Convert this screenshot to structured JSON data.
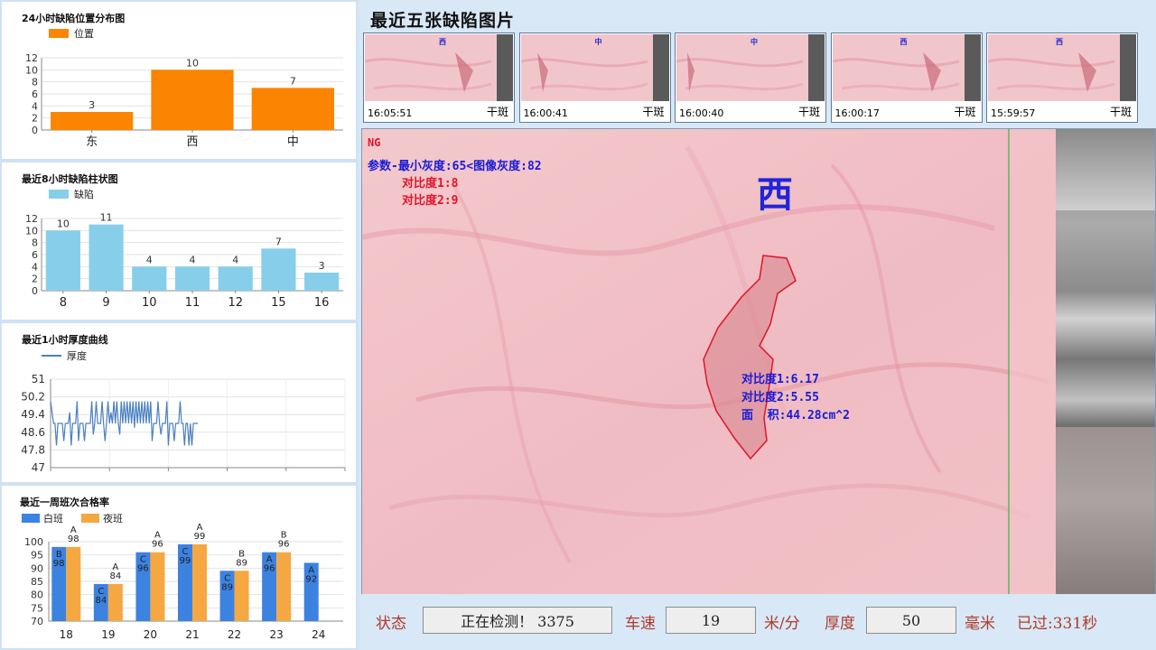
{
  "panels": {
    "position": {
      "title": "24小时缺陷位置分布图",
      "legend": "位置",
      "color": "#fb8500",
      "chart_data": {
        "type": "bar",
        "categories": [
          "东",
          "西",
          "中"
        ],
        "values": [
          3,
          10,
          7
        ],
        "ylim": [
          0,
          12
        ],
        "yticks": [
          0,
          2,
          4,
          6,
          8,
          10,
          12
        ],
        "series": [
          {
            "name": "位置",
            "values": [
              3,
              10,
              7
            ]
          }
        ]
      }
    },
    "hourly": {
      "title": "最近8小时缺陷柱状图",
      "legend": "缺陷",
      "color": "#87ceeb",
      "chart_data": {
        "type": "bar",
        "categories": [
          "8",
          "9",
          "10",
          "11",
          "12",
          "15",
          "16"
        ],
        "values": [
          10,
          11,
          4,
          4,
          4,
          7,
          3
        ],
        "ylim": [
          0,
          12
        ],
        "yticks": [
          0,
          2,
          4,
          6,
          8,
          10,
          12
        ],
        "series": [
          {
            "name": "缺陷",
            "values": [
              10,
              11,
              4,
              4,
              4,
              7,
              3
            ]
          }
        ]
      }
    },
    "thickness": {
      "title": "最近1小时厚度曲线",
      "legend": "厚度",
      "color": "#4a7fc1",
      "chart_data": {
        "type": "line",
        "ylim": [
          47,
          51
        ],
        "yticks": [
          "47",
          "47.8",
          "48.6",
          "49.4",
          "50.2",
          "51"
        ],
        "xlim": [
          0,
          100
        ],
        "x": [
          0,
          1,
          1.5,
          2,
          2.5,
          3,
          3.5,
          4,
          4.5,
          5,
          5.5,
          6,
          6.5,
          7,
          7.5,
          8,
          8.5,
          9,
          9.5,
          10,
          10.5,
          11,
          11.5,
          12,
          12.5,
          13,
          13.5,
          14,
          14.5,
          15,
          15.5,
          16,
          16.5,
          17,
          17.5,
          18,
          18.5,
          19,
          19.5,
          20,
          20.5,
          21,
          21.5,
          22,
          22.5,
          23,
          23.5,
          24,
          24.5,
          25,
          25.5,
          26,
          26.5,
          27,
          27.5,
          28,
          28.5,
          29,
          29.5,
          30,
          30.5,
          31,
          31.5,
          32,
          32.5,
          33,
          33.5,
          34,
          34.5,
          35,
          35.5,
          36,
          36.5,
          37,
          37.5,
          38,
          38.5,
          39,
          39.5,
          40,
          40.5,
          41,
          41.5,
          42,
          42.5,
          43,
          43.5,
          44,
          44.5,
          45,
          45.5,
          46,
          46.5,
          47,
          47.5,
          48,
          48.5,
          49,
          49.5,
          50
        ],
        "y": [
          50,
          49,
          49,
          48,
          49,
          49,
          49,
          49,
          48.2,
          49,
          49,
          49,
          49.5,
          48,
          49,
          49,
          49,
          50,
          48.2,
          49,
          49,
          49,
          48.2,
          49,
          49,
          49,
          49,
          50,
          48.5,
          49,
          50,
          49,
          49,
          49,
          50,
          49,
          48.2,
          49,
          50,
          49,
          49.5,
          49,
          50,
          49,
          50,
          49,
          48.5,
          50,
          49,
          50,
          49,
          50,
          49,
          50,
          49,
          50,
          48.8,
          50,
          49,
          50,
          49,
          50,
          49,
          50,
          49,
          50,
          49,
          50,
          48.2,
          49,
          49,
          49,
          50,
          49,
          48.5,
          49,
          49,
          49,
          50,
          48,
          49,
          49,
          49,
          48.2,
          49,
          49,
          49,
          50,
          49,
          49,
          48,
          49,
          49,
          48,
          49,
          48,
          49,
          49,
          49,
          49
        ]
      }
    },
    "shift": {
      "title": "最近一周班次合格率",
      "legend_day": "白班",
      "legend_night": "夜班",
      "color_day": "#3c82e0",
      "color_night": "#f5a742",
      "chart_data": {
        "type": "bar",
        "categories": [
          "18",
          "19",
          "20",
          "21",
          "22",
          "23",
          "24"
        ],
        "ylim": [
          70,
          100
        ],
        "yticks": [
          70,
          75,
          80,
          85,
          90,
          95,
          100
        ],
        "series": [
          {
            "name": "白班",
            "values": [
              98,
              84,
              96,
              99,
              89,
              96,
              92
            ],
            "grades": [
              "B",
              "C",
              "C",
              "C",
              "C",
              "A",
              "A"
            ]
          },
          {
            "name": "夜班",
            "values": [
              98,
              84,
              96,
              99,
              89,
              96,
              null
            ],
            "grades": [
              "A",
              "A",
              "A",
              "A",
              "B",
              "B",
              ""
            ]
          }
        ]
      }
    }
  },
  "right": {
    "title": "最近五张缺陷图片",
    "thumbs": [
      {
        "time": "16:05:51",
        "type": "干斑",
        "loc": "西"
      },
      {
        "time": "16:00:41",
        "type": "干斑",
        "loc": "中"
      },
      {
        "time": "16:00:40",
        "type": "干斑",
        "loc": "中"
      },
      {
        "time": "16:00:17",
        "type": "干斑",
        "loc": "西"
      },
      {
        "time": "15:59:57",
        "type": "干斑",
        "loc": "西"
      }
    ],
    "main": {
      "ng": "NG",
      "param": "参数-最小灰度:65<图像灰度:82",
      "c1": "对比度1:8",
      "c2": "对比度2:9",
      "loc": "西",
      "d1": "对比度1:6.17",
      "d2": "对比度2:5.55",
      "area": "面  积:44.28cm^2"
    },
    "status": {
      "status_label": "状态",
      "status_value": "正在检测！ 3375",
      "speed_label": "车速",
      "speed_value": "19",
      "speed_unit": "米/分",
      "thick_label": "厚度",
      "thick_value": "50",
      "thick_unit": "毫米",
      "elapsed": "已过:331秒"
    }
  }
}
